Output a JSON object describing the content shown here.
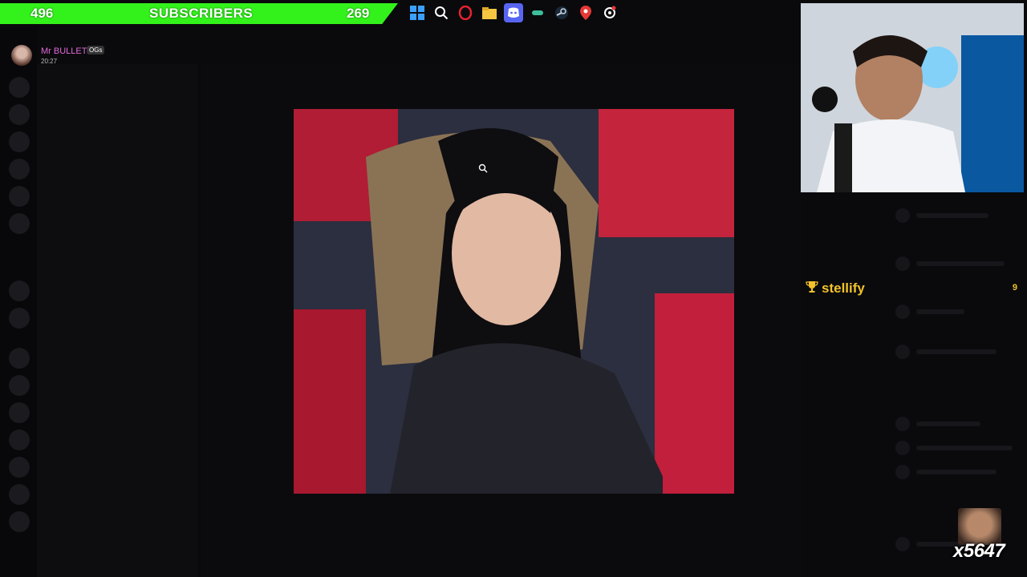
{
  "subscriber_banner": {
    "current": "496",
    "label": "SUBSCRIBERS",
    "remaining": "269",
    "color": "#33f21b"
  },
  "taskbar": {
    "icons": [
      "windows-start-icon",
      "search-icon",
      "opera-icon",
      "file-explorer-icon",
      "discord-icon",
      "app-icon",
      "steam-icon",
      "maps-pin-icon",
      "settings-icon"
    ]
  },
  "discord_message": {
    "author": "Mr BULLET",
    "badge": "OGs",
    "time": "20:27",
    "author_color": "#e26ad8"
  },
  "stellify": {
    "name": "stellify",
    "count": "9",
    "color": "#f2c32a"
  },
  "emote": {
    "label": "x5647"
  }
}
